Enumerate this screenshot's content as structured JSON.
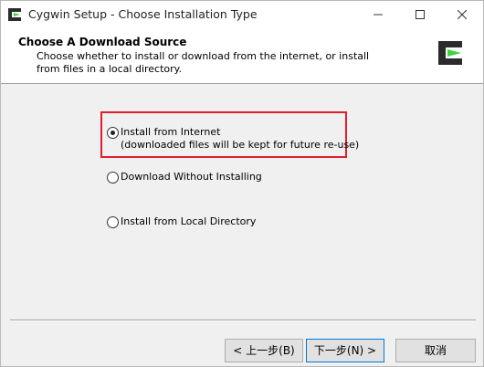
{
  "window": {
    "title": "Cygwin Setup - Choose Installation Type",
    "app_icon": "cygwin-icon",
    "controls": [
      "minimize-icon",
      "maximize-icon",
      "close-icon"
    ]
  },
  "header": {
    "title": "Choose A Download Source",
    "description": "Choose whether to install or download from the internet, or install from files in a local directory.",
    "logo": "cygwin-logo-icon"
  },
  "options": [
    {
      "label": "Install from Internet",
      "sublabel": "(downloaded files will be kept for future re-use)",
      "selected": true,
      "highlighted": true
    },
    {
      "label": "Download Without Installing",
      "selected": false
    },
    {
      "label": "Install from Local Directory",
      "selected": false
    }
  ],
  "buttons": {
    "back": "< 上一步(B)",
    "next": "下一步(N) >",
    "cancel": "取消"
  },
  "colors": {
    "highlight": "#e0202a",
    "logo_dark": "#2b2b2b",
    "logo_green": "#3fd43f"
  }
}
